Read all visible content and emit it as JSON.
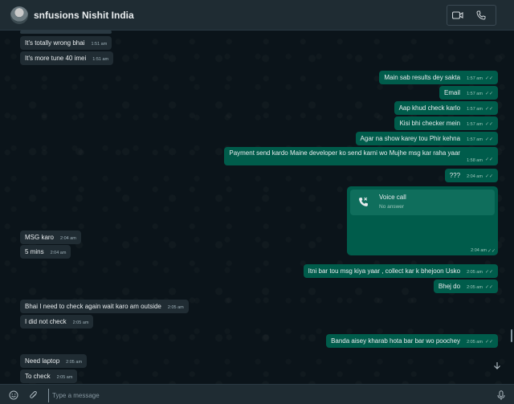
{
  "header": {
    "title": "snfusions Nishit India",
    "video_icon": "video-call-icon",
    "phone_icon": "phone-icon"
  },
  "messages": [
    {
      "dir": "in",
      "text": "It's totally wrong bhai",
      "time": "1:51 am"
    },
    {
      "dir": "in",
      "text": "It's more tune 40 imei",
      "time": "1:51 am"
    },
    {
      "dir": "out",
      "text": "Main sab results dey sakta",
      "time": "1:57 am"
    },
    {
      "dir": "out",
      "text": "Email",
      "time": "1:57 am"
    },
    {
      "dir": "out",
      "text": "Aap khud check karlo",
      "time": "1:57 am"
    },
    {
      "dir": "out",
      "text": "Kisi bhi checker mein",
      "time": "1:57 am"
    },
    {
      "dir": "out",
      "text": "Agar na show karey tou Phir kehna",
      "time": "1:57 am"
    },
    {
      "dir": "out",
      "text": "Payment send kardo Maine developer ko send karni wo Mujhe msg kar raha yaar",
      "time": "1:58 am"
    },
    {
      "dir": "out",
      "text": "???",
      "time": "2:04 am"
    },
    {
      "dir": "in",
      "text": "MSG karo",
      "time": "2:04 am"
    },
    {
      "dir": "in",
      "text": "5 mins",
      "time": "2:04 am"
    },
    {
      "dir": "out",
      "text": "Itni bar tou msg kiya yaar , collect kar k bhejoon Usko",
      "time": "2:05 am"
    },
    {
      "dir": "out",
      "text": "Bhej do",
      "time": "2:05 am"
    },
    {
      "dir": "in",
      "text": "Bhai I need to check again wait karo am outside",
      "time": "2:05 am"
    },
    {
      "dir": "in",
      "text": "I did not check",
      "time": "2:05 am"
    },
    {
      "dir": "out",
      "text": "Banda aisey kharab hota bar bar wo poochey",
      "time": "2:05 am"
    },
    {
      "dir": "in",
      "text": "Need laptop",
      "time": "2:05 am"
    },
    {
      "dir": "in",
      "text": "To check",
      "time": "2:05 am"
    }
  ],
  "call": {
    "title": "Voice call",
    "status": "No answer",
    "time": "2:04 am",
    "icon": "missed-call-icon"
  },
  "composer": {
    "placeholder": "Type a message",
    "emoji_icon": "emoji-icon",
    "attach_icon": "paperclip-icon",
    "mic_icon": "microphone-icon"
  },
  "colors": {
    "outgoing": "#005c4b",
    "incoming": "#202c33",
    "header": "#1f2c33",
    "chat_bg": "#0b141a"
  }
}
